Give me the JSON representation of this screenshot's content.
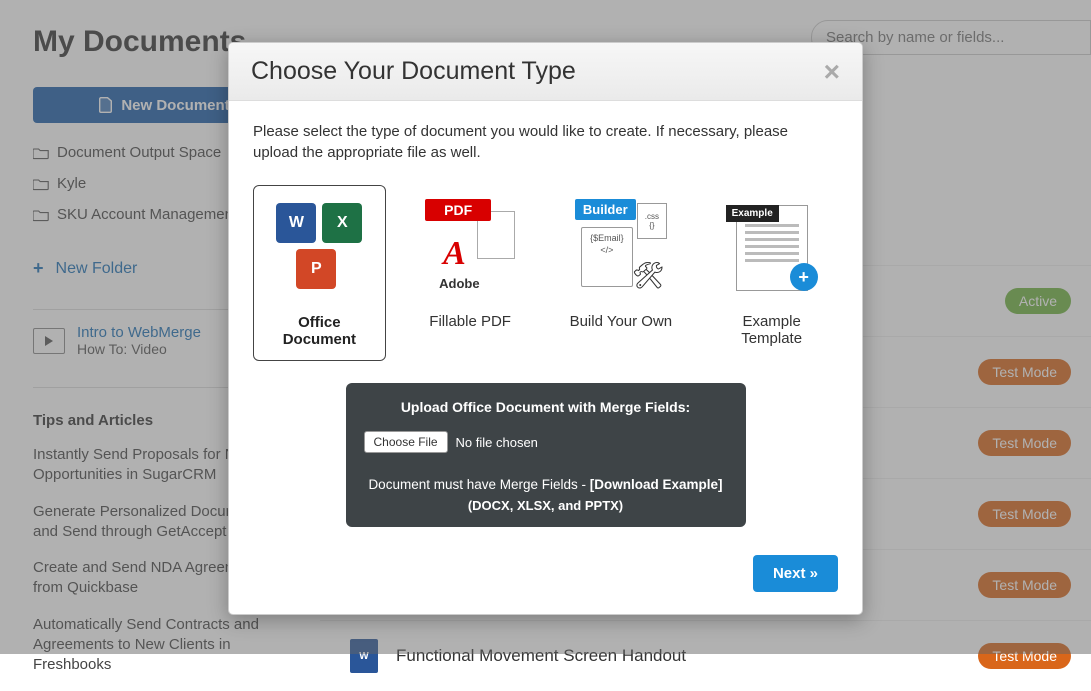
{
  "header": {
    "title": "My Documents"
  },
  "sidebar": {
    "new_document_label": "New Document",
    "folders": [
      {
        "label": "Document Output Space"
      },
      {
        "label": "Kyle"
      },
      {
        "label": "SKU Account Management"
      }
    ],
    "new_folder_label": "New Folder",
    "video": {
      "title": "Intro to WebMerge",
      "subtitle": "How To: Video"
    },
    "tips_heading": "Tips and Articles",
    "tips": [
      "Instantly Send Proposals for New Opportunities in SugarCRM",
      "Generate Personalized Documents and Send through GetAccept",
      "Create and Send NDA Agreements from Quickbase",
      "Automatically Send Contracts and Agreements to New Clients in Freshbooks"
    ]
  },
  "search": {
    "placeholder": "Search by name or fields..."
  },
  "documents": {
    "badges": {
      "active": "Active",
      "test": "Test Mode"
    },
    "rows": [
      {
        "name": "",
        "badge": "active"
      },
      {
        "name": "",
        "badge": "test"
      },
      {
        "name": "",
        "badge": "test"
      },
      {
        "name": "",
        "badge": "test"
      },
      {
        "name": "",
        "badge": "test"
      },
      {
        "name": "Functional Movement Screen Handout",
        "badge": "test"
      }
    ]
  },
  "modal": {
    "title": "Choose Your Document Type",
    "intro": "Please select the type of document you would like to create. If necessary, please upload the appropriate file as well.",
    "types": [
      {
        "label": "Office Document",
        "selected": true
      },
      {
        "label": "Fillable PDF",
        "selected": false
      },
      {
        "label": "Build Your Own",
        "selected": false
      },
      {
        "label": "Example Template",
        "selected": false
      }
    ],
    "upload": {
      "title": "Upload Office Document with Merge Fields:",
      "choose_label": "Choose File",
      "no_file": "No file chosen",
      "note_prefix": "Document must have Merge Fields - ",
      "download_link": "[Download Example]",
      "formats": "(DOCX, XLSX, and PPTX)"
    },
    "next_label": "Next »"
  }
}
